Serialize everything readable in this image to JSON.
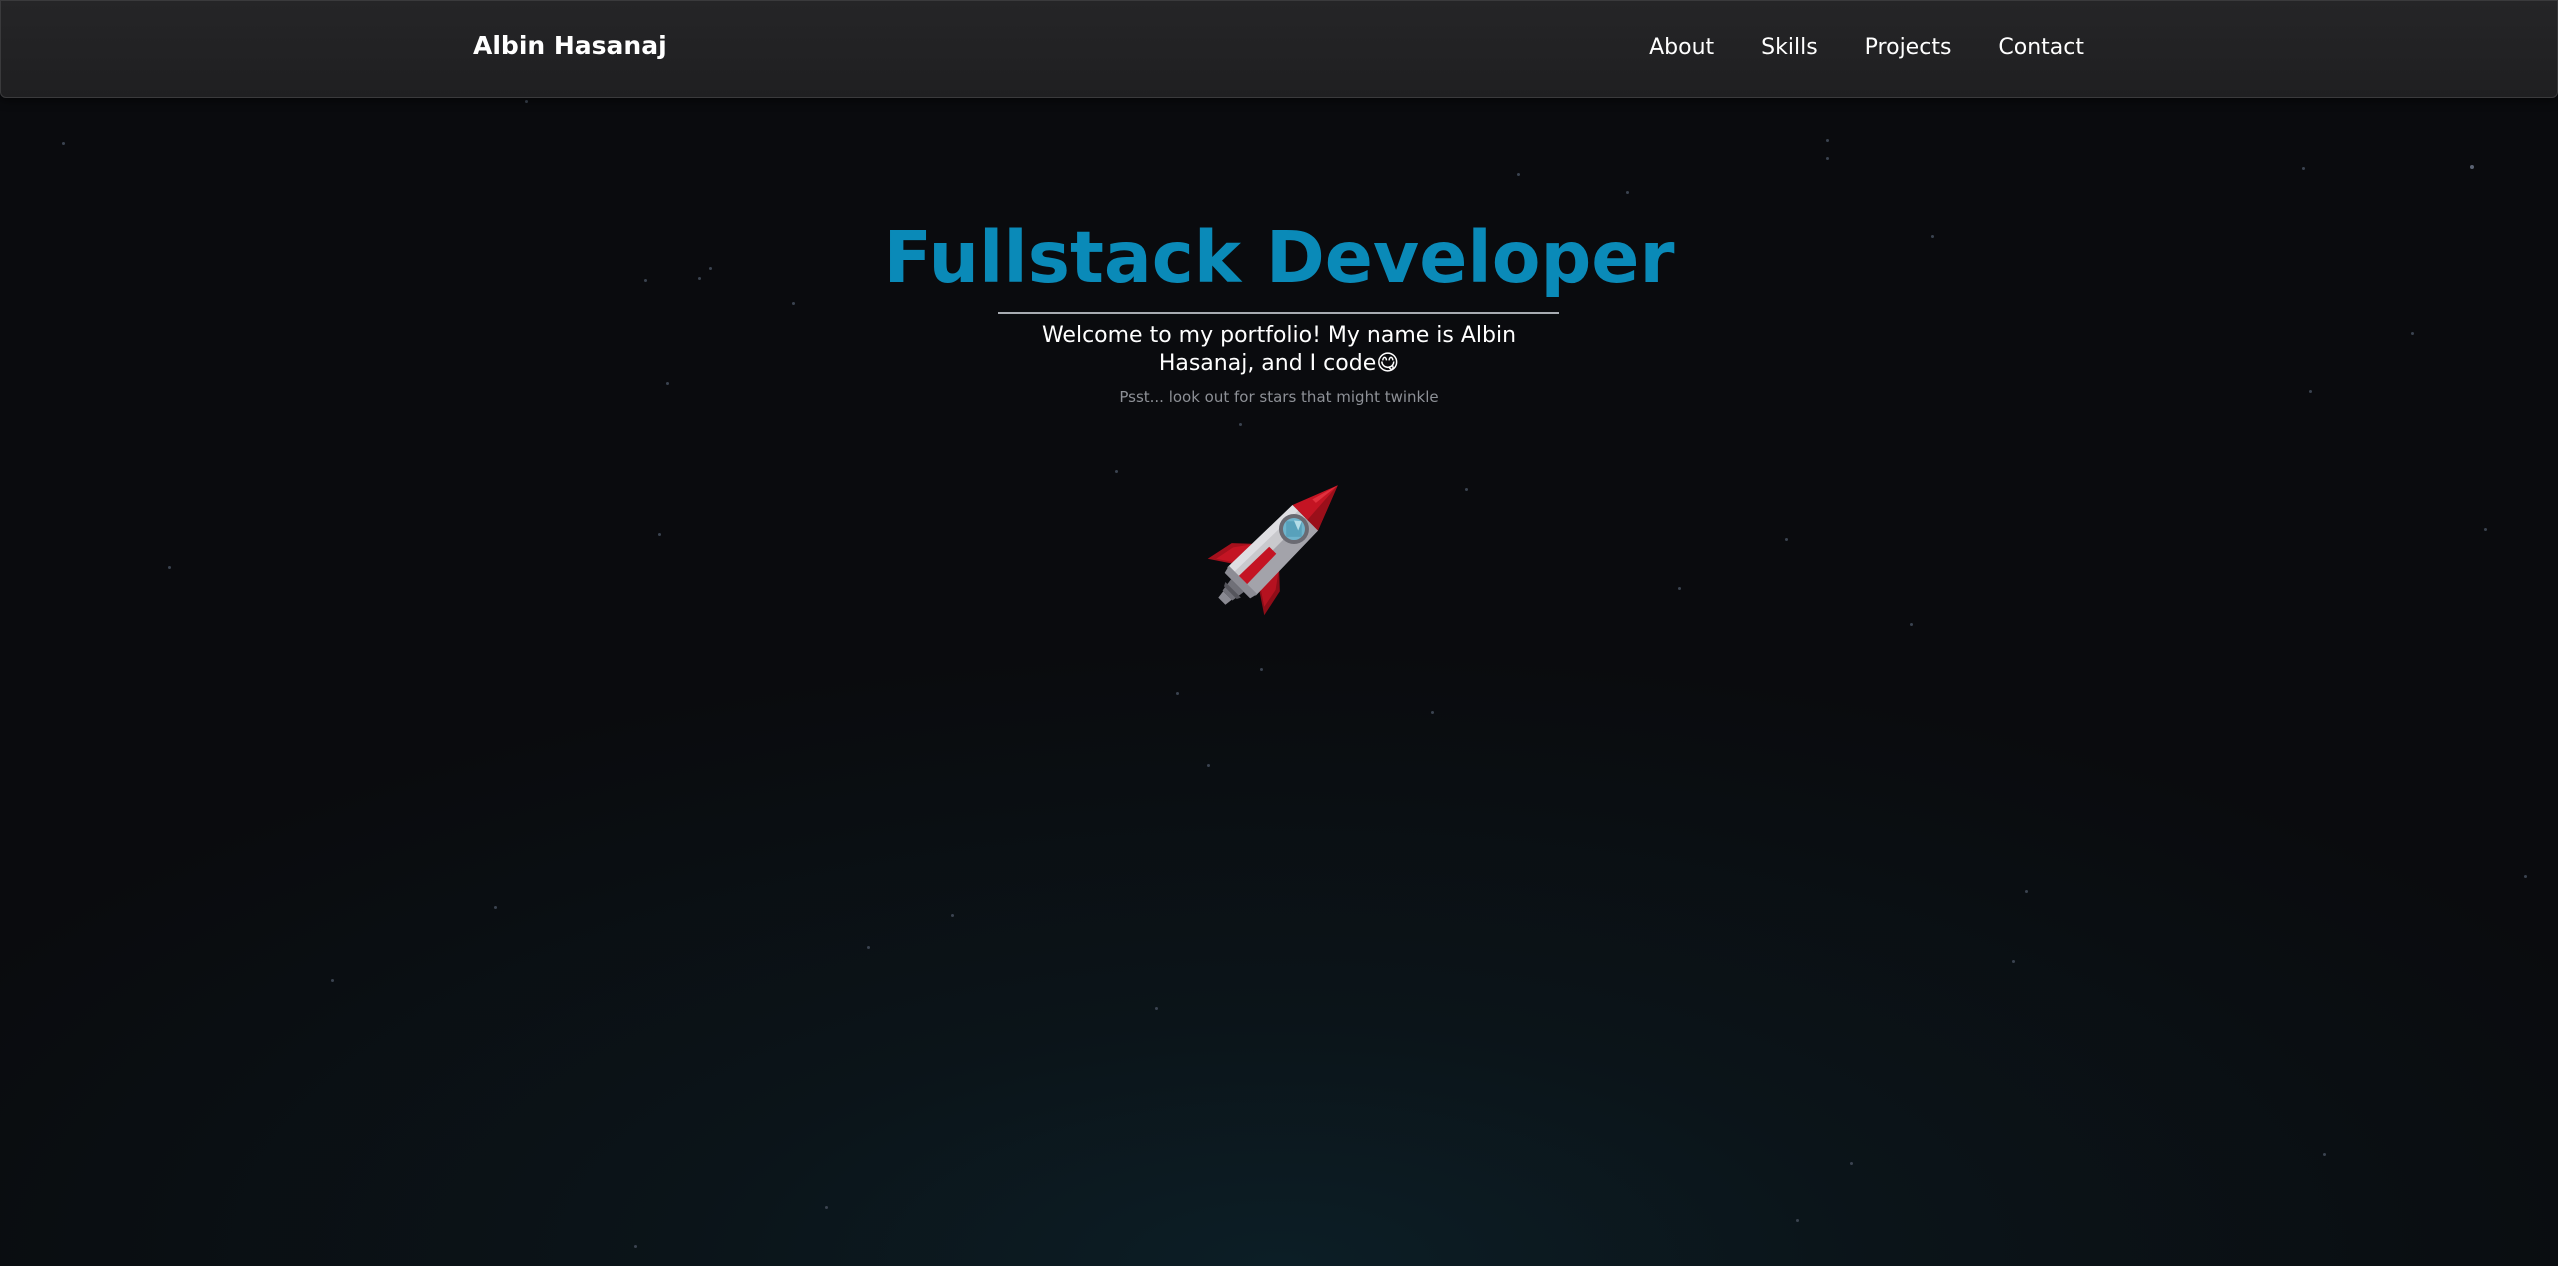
{
  "nav": {
    "brand": "Albin Hasanaj",
    "links": [
      "About",
      "Skills",
      "Projects",
      "Contact"
    ]
  },
  "hero": {
    "title": "Fullstack Developer",
    "subtitle": "Welcome to my portfolio! My name is Albin Hasanaj, and I code😋",
    "hint": "Psst... look out for stars that might twinkle",
    "illustration_icon": "rocket-icon"
  },
  "colors": {
    "accent": "#0a8ab8",
    "background": "#0a0b0e",
    "navbar": "#222224",
    "hint_text": "#8d9096",
    "rocket_body": "#c9c9cd",
    "rocket_red": "#c41423",
    "rocket_window": "#6fb4cc"
  }
}
